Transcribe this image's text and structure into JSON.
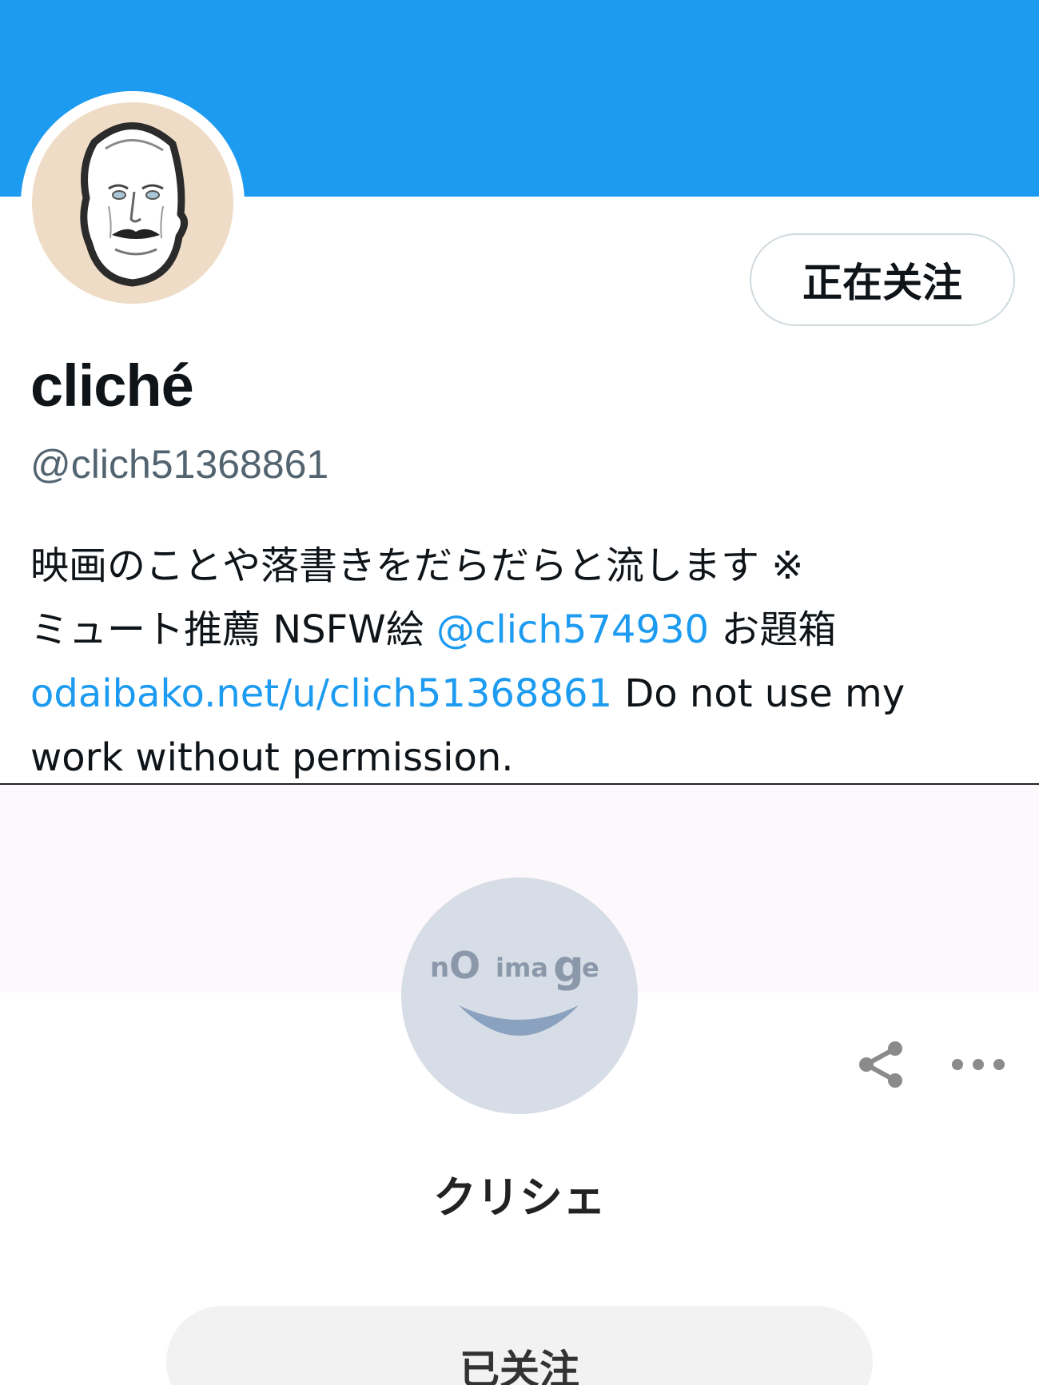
{
  "colors": {
    "banner": "#1d9bf0",
    "link": "#1d9bf0",
    "handle": "#536471",
    "noimage_bg": "#d7dde6"
  },
  "profile": {
    "display_name": "cliché",
    "handle": "@clich51368861",
    "follow_state_label": "正在关注",
    "bio": {
      "line1": "映画のことや落書きをだらだらと流します ※",
      "line2_text": "ミュート推薦 NSFW絵 ",
      "line2_mention": "@clich574930",
      "line2_tail": " お題箱",
      "line3_link": "odaibako.net/u/clich51368861",
      "line3_tail": " Do not use my",
      "line4": "work without permission."
    },
    "avatar_icon": "drawn-face-avatar"
  },
  "odaibako": {
    "placeholder_text": "nO imaGe",
    "name": "クリシェ",
    "followed_label": "已关注",
    "icons": [
      "share-icon",
      "more-icon"
    ]
  }
}
